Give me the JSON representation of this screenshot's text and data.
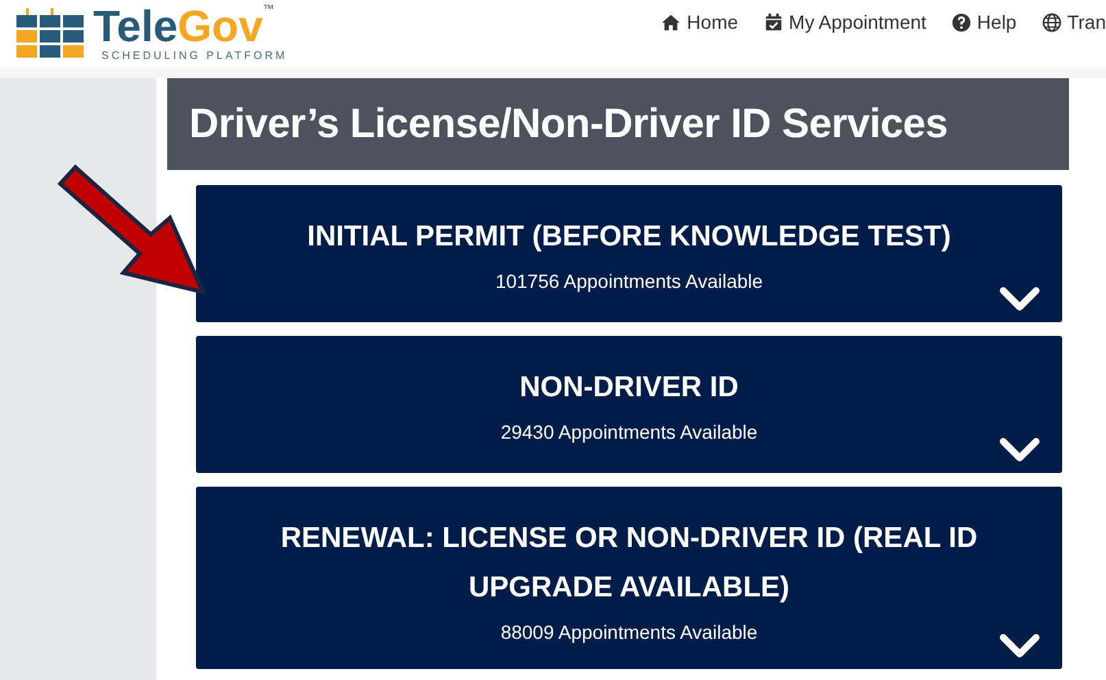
{
  "logo": {
    "name_first": "Tele",
    "name_second": "Gov",
    "trademark": "™",
    "tagline": "SCHEDULING PLATFORM"
  },
  "nav": [
    {
      "label": "Home",
      "kind": "home"
    },
    {
      "label": "My Appointment",
      "kind": "calendar"
    },
    {
      "label": "Help",
      "kind": "help"
    },
    {
      "label": "Tran",
      "kind": "globe"
    }
  ],
  "page_title": "Driver’s License/Non-Driver ID Services",
  "services": [
    {
      "title": "INITIAL PERMIT (BEFORE KNOWLEDGE TEST)",
      "availability": "101756 Appointments Available"
    },
    {
      "title": "NON-DRIVER ID",
      "availability": "29430 Appointments Available"
    },
    {
      "title": "RENEWAL: LICENSE OR NON-DRIVER ID (REAL ID UPGRADE AVAILABLE)",
      "availability": "88009 Appointments Available"
    }
  ]
}
